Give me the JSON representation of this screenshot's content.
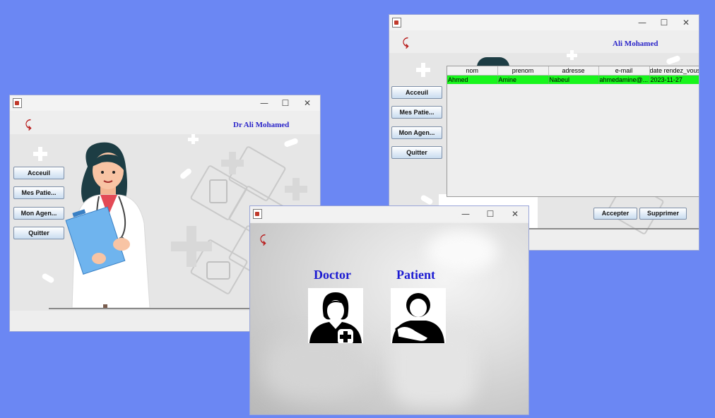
{
  "window_dashboard": {
    "doctor_name": "Dr Ali Mohamed",
    "nav": [
      "Acceuil",
      "Mes Patie...",
      "Mon Agen...",
      "Quitter"
    ]
  },
  "window_appointments": {
    "doctor_name": "Ali Mohamed",
    "nav": [
      "Acceuil",
      "Mes Patie...",
      "Mon Agen...",
      "Quitter"
    ],
    "table": {
      "columns": [
        "nom",
        "prenom",
        "adresse",
        "e-mail",
        "date rendez_vous"
      ],
      "rows": [
        [
          "Ahmed",
          "Amine",
          "Nabeul",
          "ahmedamine@...",
          "2023-11-27"
        ]
      ]
    },
    "accept_label": "Accepter",
    "delete_label": "Supprimer"
  },
  "window_role": {
    "doctor_label": "Doctor",
    "patient_label": "Patient"
  },
  "colors": {
    "background": "#6b87f3",
    "accent_text": "#2b25c9",
    "row_highlight": "#18f51c",
    "back_icon": "#b81b1b"
  }
}
